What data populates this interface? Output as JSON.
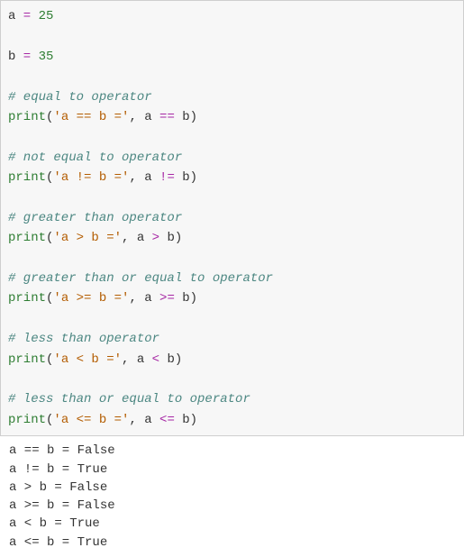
{
  "code": {
    "l1_a": "a",
    "l1_eq": " = ",
    "l1_val": "25",
    "l2_b": "b",
    "l2_eq": " = ",
    "l2_val": "35",
    "cmt_eq": "# equal to operator",
    "p_eq_fn": "print",
    "p_eq_open": "(",
    "p_eq_str": "'a == b ='",
    "p_eq_comma": ", a ",
    "p_eq_op": "==",
    "p_eq_rest": " b)",
    "cmt_ne": "# not equal to operator",
    "p_ne_fn": "print",
    "p_ne_open": "(",
    "p_ne_str": "'a != b ='",
    "p_ne_comma": ", a ",
    "p_ne_op": "!=",
    "p_ne_rest": " b)",
    "cmt_gt": "# greater than operator",
    "p_gt_fn": "print",
    "p_gt_open": "(",
    "p_gt_str": "'a > b ='",
    "p_gt_comma": ", a ",
    "p_gt_op": ">",
    "p_gt_rest": " b)",
    "cmt_ge": "# greater than or equal to operator",
    "p_ge_fn": "print",
    "p_ge_open": "(",
    "p_ge_str": "'a >= b ='",
    "p_ge_comma": ", a ",
    "p_ge_op": ">=",
    "p_ge_rest": " b)",
    "cmt_lt": "# less than operator",
    "p_lt_fn": "print",
    "p_lt_open": "(",
    "p_lt_str": "'a < b ='",
    "p_lt_comma": ", a ",
    "p_lt_op": "<",
    "p_lt_rest": " b)",
    "cmt_le": "# less than or equal to operator",
    "p_le_fn": "print",
    "p_le_open": "(",
    "p_le_str": "'a <= b ='",
    "p_le_comma": ", a ",
    "p_le_op": "<=",
    "p_le_rest": " b)"
  },
  "output": {
    "l1": "a == b = False",
    "l2": "a != b = True",
    "l3": "a > b = False",
    "l4": "a >= b = False",
    "l5": "a < b = True",
    "l6": "a <= b = True"
  }
}
